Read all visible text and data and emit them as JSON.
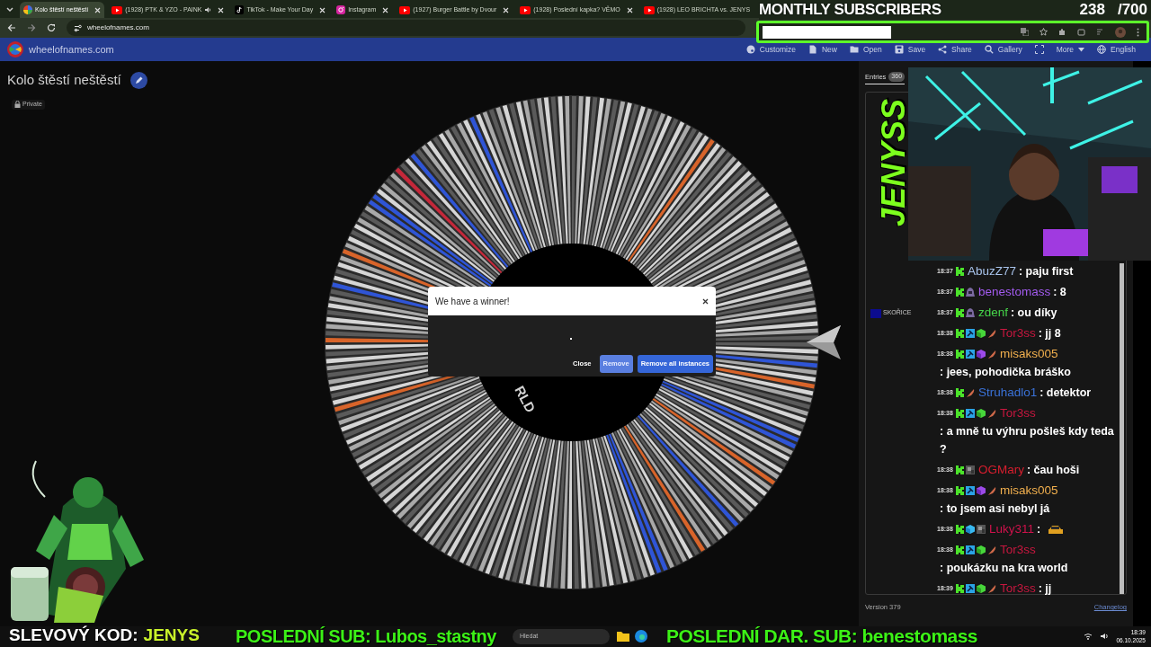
{
  "browser": {
    "tabs": [
      {
        "title": "Kolo štěstí neštěstí",
        "kind": "wheel",
        "selected": true,
        "audio": false
      },
      {
        "title": "(1928) PTK & YZO - PAINK",
        "kind": "youtube",
        "selected": false,
        "audio": true
      },
      {
        "title": "TikTok - Make Your Day",
        "kind": "tiktok",
        "selected": false,
        "audio": false
      },
      {
        "title": "Instagram",
        "kind": "instagram",
        "selected": false,
        "audio": false
      },
      {
        "title": "(1927) Burger Battle by Dvour",
        "kind": "youtube",
        "selected": false,
        "audio": false
      },
      {
        "title": "(1928) Poslední kapka? VĚMO",
        "kind": "youtube",
        "selected": false,
        "audio": false
      },
      {
        "title": "(1928) LEO BRICHTA vs. JENYS",
        "kind": "youtube",
        "selected": false,
        "audio": false
      }
    ],
    "url": "wheelofnames.com"
  },
  "subscriber_goal": {
    "label": "MONTHLY SUBSCRIBERS",
    "count": "238",
    "goal": "/700"
  },
  "app_bar": {
    "brand": "wheelofnames.com",
    "menu": [
      {
        "label": "Customize",
        "kind": "palette"
      },
      {
        "label": "New",
        "kind": "file"
      },
      {
        "label": "Open",
        "kind": "folder"
      },
      {
        "label": "Save",
        "kind": "save"
      },
      {
        "label": "Share",
        "kind": "share"
      },
      {
        "label": "Gallery",
        "kind": "search"
      },
      {
        "kind": "fullscreen"
      },
      {
        "label": "More",
        "kind": "more"
      },
      {
        "label": "English",
        "kind": "globe"
      }
    ]
  },
  "wheel": {
    "title": "Kolo štěstí neštěstí",
    "visibility": "Private",
    "center_text": "RLD"
  },
  "dialog": {
    "title": "We have a winner!",
    "buttons": [
      {
        "label": "Close",
        "kind": "text"
      },
      {
        "label": "Remove",
        "kind": "secondary"
      },
      {
        "label": "Remove all instances",
        "kind": "primary"
      }
    ]
  },
  "entries_panel": {
    "tab": "Entries",
    "count": "360",
    "entries": [
      {
        "label": "SKOŘICE",
        "color": "#0c0c8e"
      }
    ],
    "version": "Version 379",
    "changelog": "Changelog"
  },
  "stream_logo": "JENYSS",
  "chat": [
    {
      "time": "18:37",
      "badges": [
        {
          "kind": "chevron"
        }
      ],
      "user": "AbuzZ77",
      "color": "#a9c4ec",
      "text": ": paju first"
    },
    {
      "time": "18:37",
      "badges": [
        {
          "kind": "chevron"
        },
        {
          "kind": "hooded"
        }
      ],
      "user": "benestomass",
      "color": "#a35bf0",
      "text": ": 8"
    },
    {
      "time": "18:37",
      "badges": [
        {
          "kind": "chevron"
        },
        {
          "kind": "hooded"
        }
      ],
      "user": "zdenf",
      "color": "#46d64a",
      "text": ": ou díky"
    },
    {
      "time": "18:38",
      "badges": [
        {
          "kind": "chevron"
        },
        {
          "kind": "hammer"
        },
        {
          "kind": "cube-green"
        },
        {
          "kind": "feather"
        }
      ],
      "user": "Tor3ss",
      "color": "#c8173f",
      "text": ": jj 8"
    },
    {
      "time": "18:38",
      "badges": [
        {
          "kind": "chevron"
        },
        {
          "kind": "hammer"
        },
        {
          "kind": "cube-purple"
        },
        {
          "kind": "feather"
        }
      ],
      "user": "misaks005",
      "color": "#f2b04e",
      "text": ": jees, pohodička bráško"
    },
    {
      "time": "18:38",
      "badges": [
        {
          "kind": "chevron"
        },
        {
          "kind": "feather"
        }
      ],
      "user": "Struhadlo1",
      "color": "#3a72d8",
      "text": ": detektor"
    },
    {
      "time": "18:38",
      "badges": [
        {
          "kind": "chevron"
        },
        {
          "kind": "hammer"
        },
        {
          "kind": "cube-green"
        },
        {
          "kind": "feather"
        }
      ],
      "user": "Tor3ss",
      "color": "#c8173f",
      "text": ": a mně tu výhru pošleš kdy teda ?"
    },
    {
      "time": "18:38",
      "badges": [
        {
          "kind": "chevron"
        },
        {
          "kind": "pixel"
        }
      ],
      "user": "OGMary",
      "color": "#d81e2e",
      "text": ": čau hoši"
    },
    {
      "time": "18:38",
      "badges": [
        {
          "kind": "chevron"
        },
        {
          "kind": "hammer"
        },
        {
          "kind": "cube-purple"
        },
        {
          "kind": "feather"
        }
      ],
      "user": "misaks005",
      "color": "#f2b04e",
      "text": ": to jsem asi nebyl já"
    },
    {
      "time": "18:38",
      "badges": [
        {
          "kind": "chevron"
        },
        {
          "kind": "cube-blue"
        },
        {
          "kind": "pixel"
        }
      ],
      "user": "Luky311",
      "color": "#d0124c",
      "text": ":",
      "emote": true
    },
    {
      "time": "18:38",
      "badges": [
        {
          "kind": "chevron"
        },
        {
          "kind": "hammer"
        },
        {
          "kind": "cube-green"
        },
        {
          "kind": "feather"
        }
      ],
      "user": "Tor3ss",
      "color": "#c8173f",
      "text": ": poukázku na kra world"
    },
    {
      "time": "18:39",
      "badges": [
        {
          "kind": "chevron"
        },
        {
          "kind": "hammer"
        },
        {
          "kind": "cube-green"
        },
        {
          "kind": "feather"
        }
      ],
      "user": "Tor3ss",
      "color": "#c8173f",
      "text": ": jj"
    }
  ],
  "stream_overlay": {
    "promo_label": "SLEVOVÝ KOD:",
    "promo_code": "JENYS",
    "last_sub": "POSLEDNÍ SUB: Lubos_stastny",
    "last_gift": "POSLEDNÍ DAR. SUB: benestomass"
  },
  "taskbar": {
    "search": "Hledat",
    "time": "18:39",
    "date": "06.10.2025"
  }
}
